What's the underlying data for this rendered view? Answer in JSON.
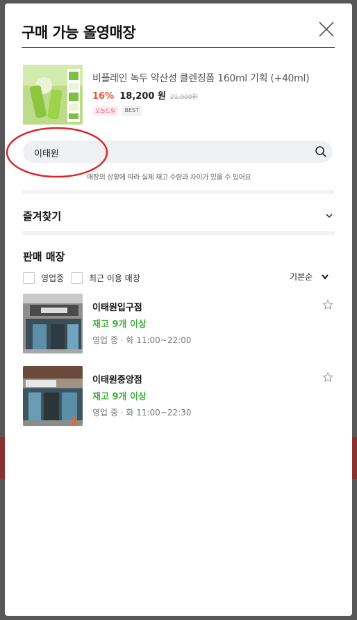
{
  "modal": {
    "title": "구매 가능 올영매장"
  },
  "product": {
    "name": "비플레인 녹두 약산성 클렌징폼 160ml 기획 (+40ml)",
    "discount": "16%",
    "price": "18,200 원",
    "original_price": "21,900원",
    "badges": [
      "오늘드림",
      "BEST"
    ]
  },
  "search": {
    "value": "이태원",
    "notice": "매장의 상황에 따라 실제 재고 수량과 차이가 있을 수 있어요"
  },
  "favorites": {
    "label": "즐겨찾기"
  },
  "stores_section": {
    "title": "판매 매장",
    "filters": [
      {
        "label": "영업중",
        "checked": false
      },
      {
        "label": "최근 이용 매장",
        "checked": false
      }
    ],
    "sort_label": "기본순"
  },
  "stores": [
    {
      "name": "이태원입구점",
      "stock": "재고 9개 이상",
      "hours": "영업 중 · 화 11:00~22:00",
      "favorited": false
    },
    {
      "name": "이태원중앙점",
      "stock": "재고 9개 이상",
      "hours": "영업 중 · 화 11:00~22:30",
      "favorited": false
    }
  ],
  "colors": {
    "discount": "#f1502f",
    "stock": "#3fb13a",
    "annotation_circle": "#d9262c",
    "badge_pink": "#f0517a"
  },
  "icons": {
    "close": "close-icon",
    "search": "search-icon",
    "chevron": "chevron-down-icon",
    "favorite": "star-outline-icon"
  }
}
